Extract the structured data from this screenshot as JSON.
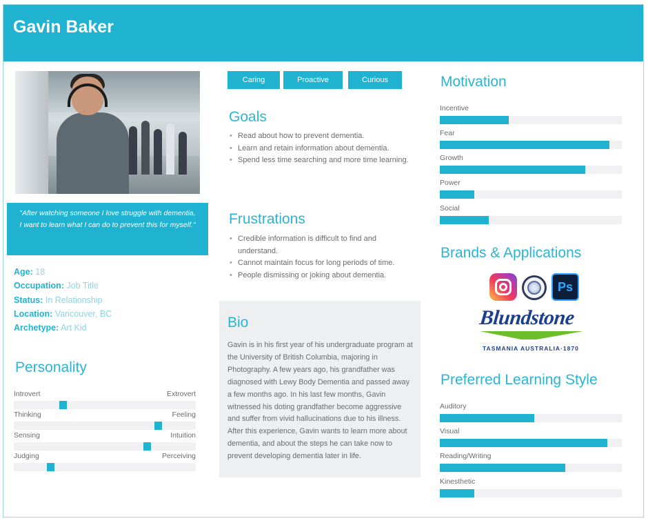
{
  "header": {
    "name": "Gavin Baker"
  },
  "profile": {
    "quote": "\"After watching someone I love struggle with dementia, I want to learn what I can do to prevent this for myself.\"",
    "facts": [
      {
        "key": "Age:",
        "value": "18"
      },
      {
        "key": "Occupation:",
        "value": "Job Title"
      },
      {
        "key": "Status:",
        "value": "In Relationship"
      },
      {
        "key": "Location:",
        "value": "Vancouver, BC"
      },
      {
        "key": "Archetype:",
        "value": "Art Kid"
      }
    ]
  },
  "personality": {
    "title": "Personality",
    "scales": [
      {
        "left": "Introvert",
        "right": "Extrovert",
        "position": 0.27
      },
      {
        "left": "Thinking",
        "right": "Feeling",
        "position": 0.79
      },
      {
        "left": "Sensing",
        "right": "Intuition",
        "position": 0.73
      },
      {
        "left": "Judging",
        "right": "Perceiving",
        "position": 0.2
      }
    ]
  },
  "traits": [
    "Caring",
    "Proactive",
    "Curious"
  ],
  "goals": {
    "title": "Goals",
    "items": [
      "Read about how to prevent dementia.",
      "Learn and retain information about dementia.",
      "Spend less time searching and more time learning."
    ]
  },
  "frustrations": {
    "title": "Frustrations",
    "items": [
      "Credible information is difficult to find and understand.",
      "Cannot maintain focus for long periods of time.",
      "People dismissing or joking about dementia."
    ]
  },
  "bio": {
    "title": "Bio",
    "text": "Gavin is in his first year of his undergraduate program at the University of British Columbia, majoring in Photography. A few years ago, his grandfather was diagnosed with Lewy Body Dementia and passed away a few months ago. In his last few months, Gavin witnessed his doting grandfather become aggressive and suffer from vivid hallucinations due to his illness. After this experience, Gavin wants to learn more about dementia, and about the steps he can take now to prevent developing dementia later in life."
  },
  "motivation": {
    "title": "Motivation",
    "items": [
      {
        "label": "Incentive",
        "level": 0.38
      },
      {
        "label": "Fear",
        "level": 0.93
      },
      {
        "label": "Growth",
        "level": 0.8
      },
      {
        "label": "Power",
        "level": 0.19
      },
      {
        "label": "Social",
        "level": 0.27
      }
    ]
  },
  "brands": {
    "title": "Brands & Applications",
    "icons": [
      "instagram-icon",
      "seal-icon",
      "photoshop-icon",
      "blundstone-logo"
    ],
    "ps_label": "Ps",
    "blundstone": "Blundstone",
    "blundstone_sub": "TASMANIA AUSTRALIA·1870"
  },
  "learning": {
    "title": "Preferred Learning Style",
    "items": [
      {
        "label": "Auditory",
        "level": 0.52
      },
      {
        "label": "Visual",
        "level": 0.92
      },
      {
        "label": "Reading/Writing",
        "level": 0.69
      },
      {
        "label": "Kinesthetic",
        "level": 0.19
      }
    ]
  },
  "colors": {
    "accent": "#1fb3d1",
    "track": "#f1f1f3",
    "bio_bg": "#eeeff1"
  }
}
